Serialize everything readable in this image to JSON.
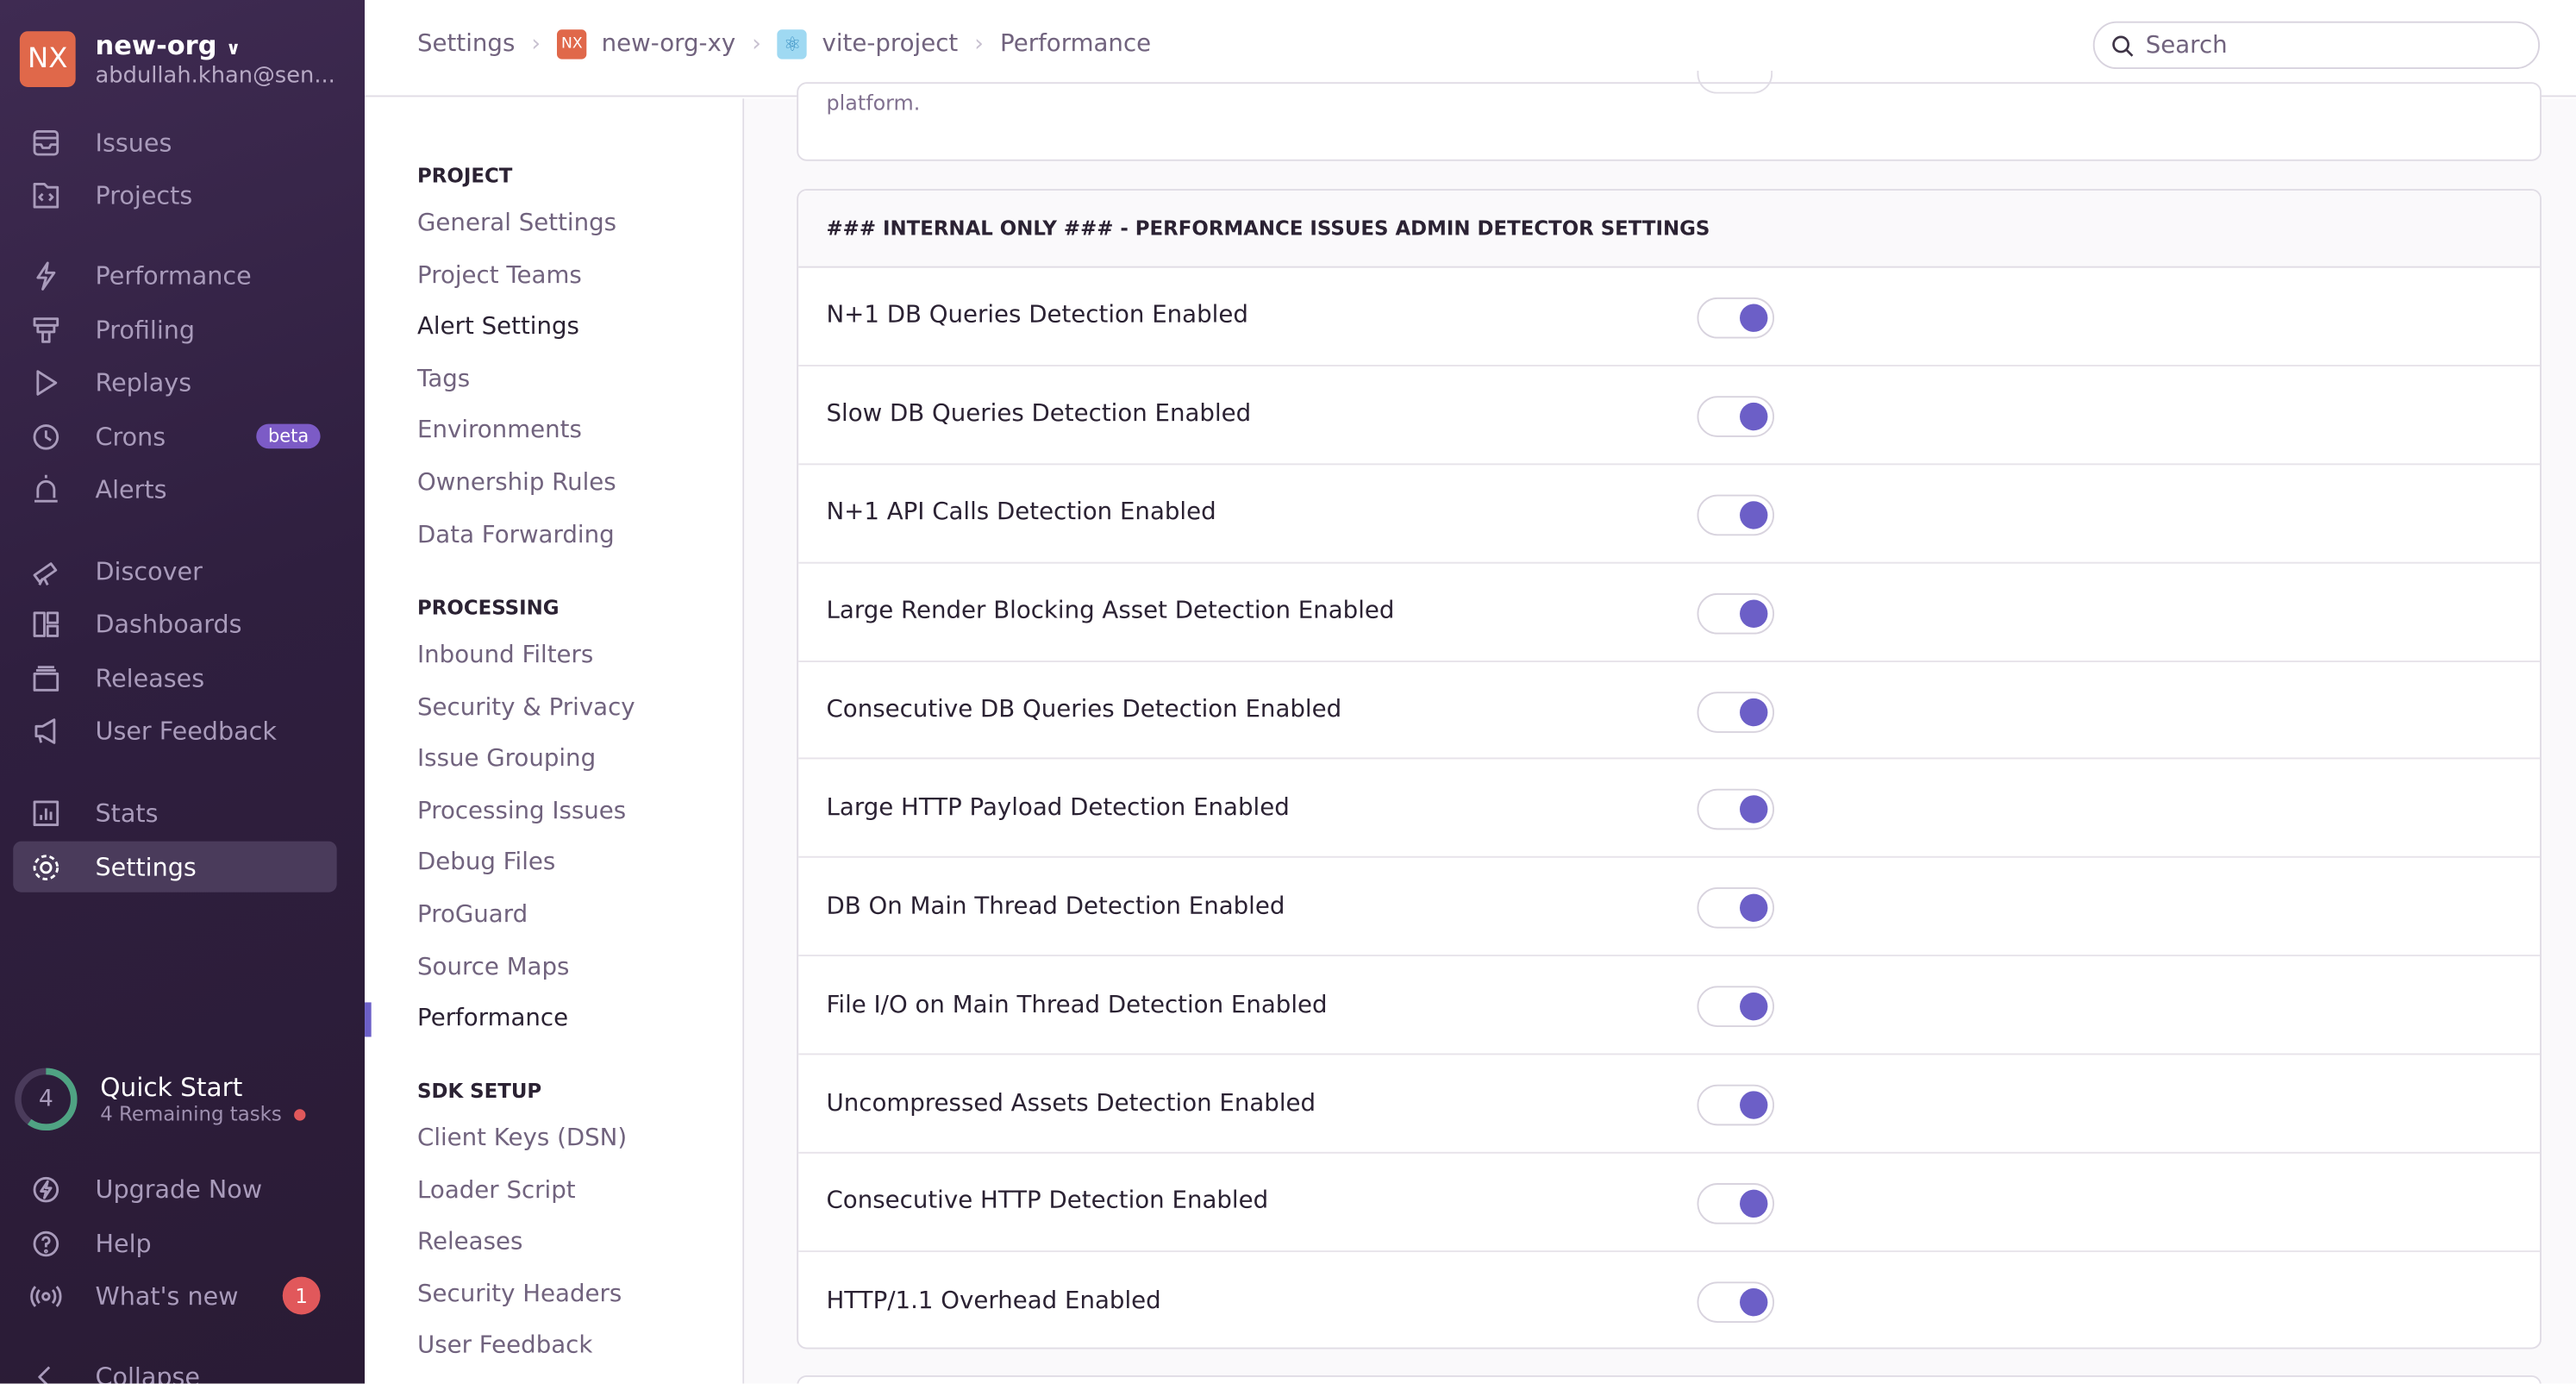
{
  "org": {
    "badge": "NX",
    "name": "new-org",
    "email": "abdullah.khan@sen..."
  },
  "sidebar": {
    "items": [
      {
        "label": "Issues",
        "icon": "issues-icon"
      },
      {
        "label": "Projects",
        "icon": "projects-icon"
      },
      {
        "label": "Performance",
        "icon": "lightning-icon"
      },
      {
        "label": "Profiling",
        "icon": "profiling-icon"
      },
      {
        "label": "Replays",
        "icon": "play-icon"
      },
      {
        "label": "Crons",
        "icon": "clock-icon",
        "badge": "beta"
      },
      {
        "label": "Alerts",
        "icon": "siren-icon"
      },
      {
        "label": "Discover",
        "icon": "telescope-icon"
      },
      {
        "label": "Dashboards",
        "icon": "dashboard-icon"
      },
      {
        "label": "Releases",
        "icon": "releases-icon"
      },
      {
        "label": "User Feedback",
        "icon": "megaphone-icon"
      },
      {
        "label": "Stats",
        "icon": "stats-icon"
      },
      {
        "label": "Settings",
        "icon": "gear-icon",
        "active": true
      }
    ],
    "quick_start": {
      "count": "4",
      "title": "Quick Start",
      "subtitle": "4 Remaining tasks",
      "progress": 0.6
    },
    "bottom": [
      {
        "label": "Upgrade Now",
        "icon": "upgrade-icon"
      },
      {
        "label": "Help",
        "icon": "help-icon"
      },
      {
        "label": "What's new",
        "icon": "broadcast-icon",
        "badge": "1"
      },
      {
        "label": "Collapse",
        "icon": "chevron-left-icon"
      }
    ],
    "colors": {
      "accent": "#6c5fc7",
      "org": "#e0684a",
      "badge": "#e1585b"
    }
  },
  "breadcrumb": {
    "items": [
      "Settings",
      "new-org-xy",
      "vite-project",
      "Performance"
    ],
    "org_badge": "NX"
  },
  "search": {
    "placeholder": "Search"
  },
  "subnav": {
    "sections": [
      {
        "title": "PROJECT",
        "items": [
          "General Settings",
          "Project Teams",
          "Alert Settings",
          "Tags",
          "Environments",
          "Ownership Rules",
          "Data Forwarding"
        ]
      },
      {
        "title": "PROCESSING",
        "items": [
          "Inbound Filters",
          "Security & Privacy",
          "Issue Grouping",
          "Processing Issues",
          "Debug Files",
          "ProGuard",
          "Source Maps",
          "Performance"
        ]
      },
      {
        "title": "SDK SETUP",
        "items": [
          "Client Keys (DSN)",
          "Loader Script",
          "Releases",
          "Security Headers",
          "User Feedback"
        ]
      }
    ]
  },
  "main": {
    "top_card_desc": "platform.",
    "panel_title": "### INTERNAL ONLY ### - PERFORMANCE ISSUES ADMIN DETECTOR SETTINGS",
    "rows": [
      {
        "label": "N+1 DB Queries Detection Enabled",
        "enabled": true
      },
      {
        "label": "Slow DB Queries Detection Enabled",
        "enabled": true
      },
      {
        "label": "N+1 API Calls Detection Enabled",
        "enabled": true
      },
      {
        "label": "Large Render Blocking Asset Detection Enabled",
        "enabled": true
      },
      {
        "label": "Consecutive DB Queries Detection Enabled",
        "enabled": true
      },
      {
        "label": "Large HTTP Payload Detection Enabled",
        "enabled": true
      },
      {
        "label": "DB On Main Thread Detection Enabled",
        "enabled": true
      },
      {
        "label": "File I/O on Main Thread Detection Enabled",
        "enabled": true
      },
      {
        "label": "Uncompressed Assets Detection Enabled",
        "enabled": true
      },
      {
        "label": "Consecutive HTTP Detection Enabled",
        "enabled": true
      },
      {
        "label": "HTTP/1.1 Overhead Enabled",
        "enabled": true
      }
    ]
  }
}
